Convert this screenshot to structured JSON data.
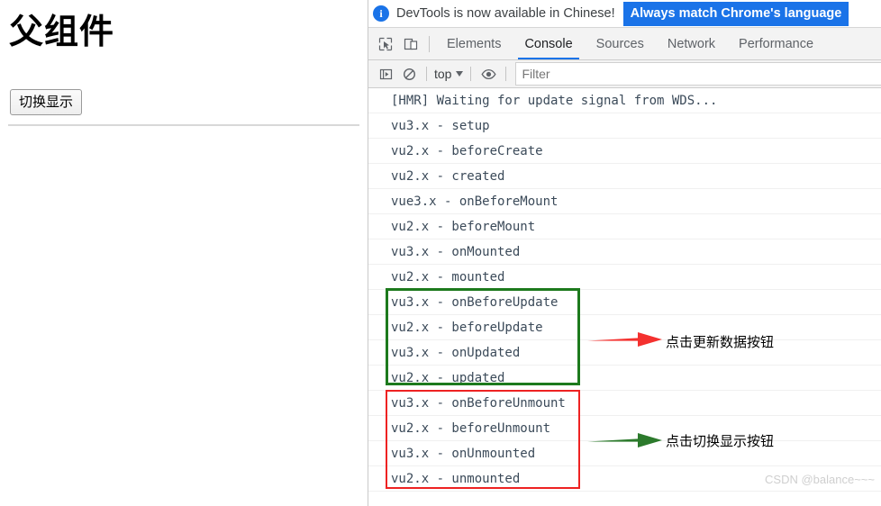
{
  "page": {
    "title": "父组件",
    "toggle_button_label": "切换显示"
  },
  "devtools": {
    "banner": {
      "icon": "info-icon",
      "message": "DevTools is now available in Chinese!",
      "action_label": "Always match Chrome's language",
      "accent_color": "#1a73e8"
    },
    "toolbar_icons": [
      {
        "name": "inspect-element-icon",
        "glyph": "inspect"
      },
      {
        "name": "device-toolbar-icon",
        "glyph": "device"
      }
    ],
    "tabs": [
      {
        "label": "Elements",
        "active": false
      },
      {
        "label": "Console",
        "active": true
      },
      {
        "label": "Sources",
        "active": false
      },
      {
        "label": "Network",
        "active": false
      },
      {
        "label": "Performance",
        "active": false
      }
    ],
    "console_toolbar": {
      "execute_icon": "console-sidebar-icon",
      "clear_icon": "clear-console-icon",
      "context_value": "top",
      "eye_icon": "live-expression-icon",
      "filter_placeholder": "Filter",
      "filter_value": ""
    },
    "console_logs": [
      {
        "text": "[HMR] Waiting for update signal from WDS..."
      },
      {
        "text": "vu3.x - setup"
      },
      {
        "text": "vu2.x - beforeCreate"
      },
      {
        "text": "vu2.x - created"
      },
      {
        "text": "vue3.x - onBeforeMount"
      },
      {
        "text": "vu2.x - beforeMount"
      },
      {
        "text": "vu3.x - onMounted"
      },
      {
        "text": "vu2.x - mounted"
      },
      {
        "text": "vu3.x - onBeforeUpdate"
      },
      {
        "text": "vu2.x - beforeUpdate"
      },
      {
        "text": "vu3.x - onUpdated"
      },
      {
        "text": "vu2.x - updated"
      },
      {
        "text": "vu3.x - onBeforeUnmount"
      },
      {
        "text": "vu2.x - beforeUnmount"
      },
      {
        "text": "vu3.x - onUnmounted"
      },
      {
        "text": "vu2.x - unmounted"
      }
    ],
    "annotations": [
      {
        "name": "update-group",
        "box_color": "#1d7a1d",
        "arrow_color": "#ee3333",
        "label": "点击更新数据按钮"
      },
      {
        "name": "unmount-group",
        "box_color": "#ee2222",
        "arrow_color": "#1d7a1d",
        "label": "点击切换显示按钮"
      }
    ],
    "watermark": "CSDN @balance~~~"
  }
}
